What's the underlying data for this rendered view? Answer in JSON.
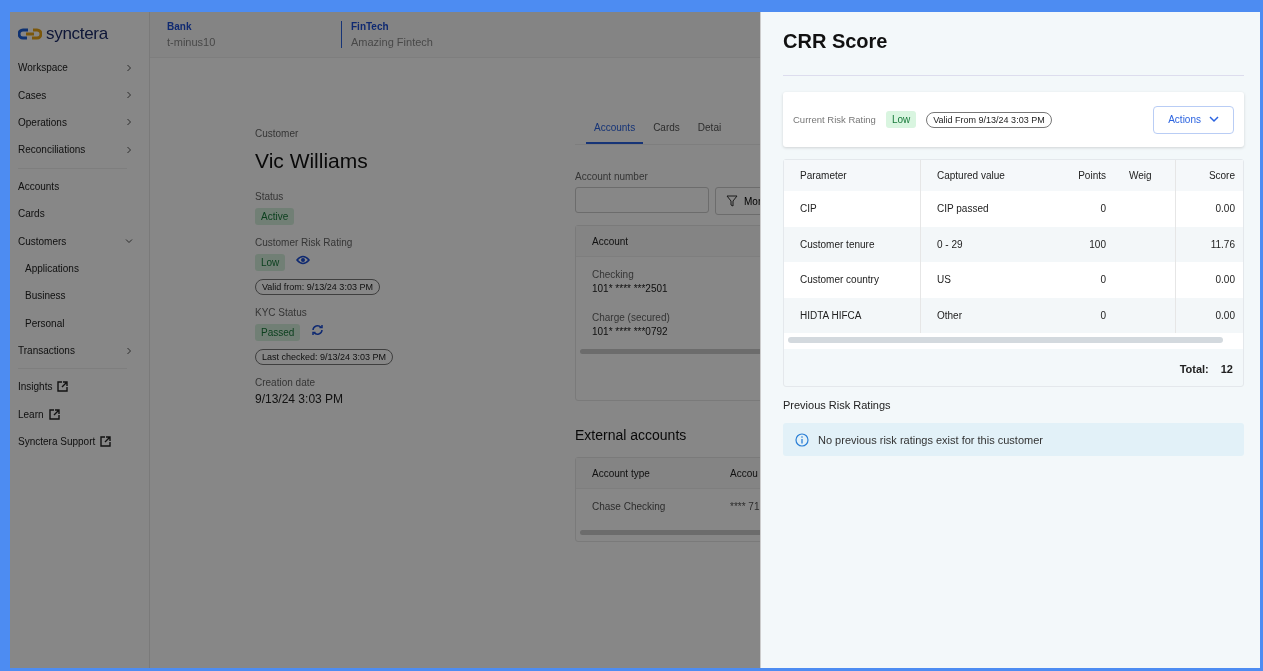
{
  "sidebar": {
    "logo": "synctera",
    "groups": [
      {
        "items": [
          {
            "label": "Workspace",
            "kind": "collapsible",
            "expanded": false
          },
          {
            "label": "Cases",
            "kind": "collapsible",
            "expanded": false
          },
          {
            "label": "Operations",
            "kind": "collapsible",
            "expanded": false
          },
          {
            "label": "Reconciliations",
            "kind": "collapsible",
            "expanded": false
          }
        ]
      },
      {
        "items": [
          {
            "label": "Accounts",
            "kind": "link"
          },
          {
            "label": "Cards",
            "kind": "link"
          },
          {
            "label": "Customers",
            "kind": "collapsible",
            "expanded": true,
            "children": [
              {
                "label": "Applications"
              },
              {
                "label": "Business"
              },
              {
                "label": "Personal"
              }
            ]
          },
          {
            "label": "Transactions",
            "kind": "collapsible",
            "expanded": false
          }
        ]
      },
      {
        "items": [
          {
            "label": "Insights",
            "kind": "external"
          },
          {
            "label": "Learn",
            "kind": "external"
          },
          {
            "label": "Synctera Support",
            "kind": "external"
          }
        ]
      }
    ]
  },
  "header": [
    {
      "label": "Bank",
      "value": "t-minus10"
    },
    {
      "label": "FinTech",
      "value": "Amazing Fintech"
    }
  ],
  "customer": {
    "caption": "Customer",
    "name": "Vic Williams",
    "status": {
      "label": "Status",
      "value": "Active"
    },
    "risk": {
      "label": "Customer Risk Rating",
      "value": "Low",
      "chip": "Valid from: 9/13/24 3:03 PM"
    },
    "kyc": {
      "label": "KYC Status",
      "value": "Passed",
      "chip": "Last checked: 9/13/24 3:03 PM"
    },
    "created": {
      "label": "Creation date",
      "value": "9/13/24 3:03 PM"
    }
  },
  "tabs": [
    {
      "label": "Accounts",
      "selected": true
    },
    {
      "label": "Cards",
      "selected": false
    },
    {
      "label": "Detai",
      "selected": false
    }
  ],
  "account_filter": {
    "label": "Account number",
    "button": "Mor"
  },
  "accounts_table": {
    "columns": [
      "Account"
    ],
    "rows": [
      {
        "type": "Checking",
        "number": "101* **** ***2501"
      },
      {
        "type": "Charge (secured)",
        "number": "101* **** ***0792"
      }
    ]
  },
  "external_accounts": {
    "title": "External accounts",
    "columns": [
      "Account type",
      "Accou"
    ],
    "rows": [
      [
        "Chase Checking",
        "**** 71"
      ]
    ]
  },
  "drawer": {
    "title": "CRR Score",
    "rating": {
      "label": "Current Risk Rating",
      "value": "Low",
      "chip": "Valid From 9/13/24 3:03 PM",
      "button": "Actions"
    },
    "table": {
      "columns": [
        "Parameter",
        "Captured value",
        "Points",
        "Weig",
        "Score"
      ],
      "rows": [
        {
          "parameter": "CIP",
          "captured_value": "CIP passed",
          "points": "0",
          "score": "0.00"
        },
        {
          "parameter": "Customer tenure",
          "captured_value": "0 - 29",
          "points": "100",
          "score": "11.76"
        },
        {
          "parameter": "Customer country",
          "captured_value": "US",
          "points": "0",
          "score": "0.00"
        },
        {
          "parameter": "HIDTA HIFCA",
          "captured_value": "Other",
          "points": "0",
          "score": "0.00"
        }
      ],
      "total_label": "Total:",
      "total": "12"
    },
    "previous": {
      "title": "Previous Risk Ratings",
      "message": "No previous risk ratings exist for this customer"
    }
  }
}
